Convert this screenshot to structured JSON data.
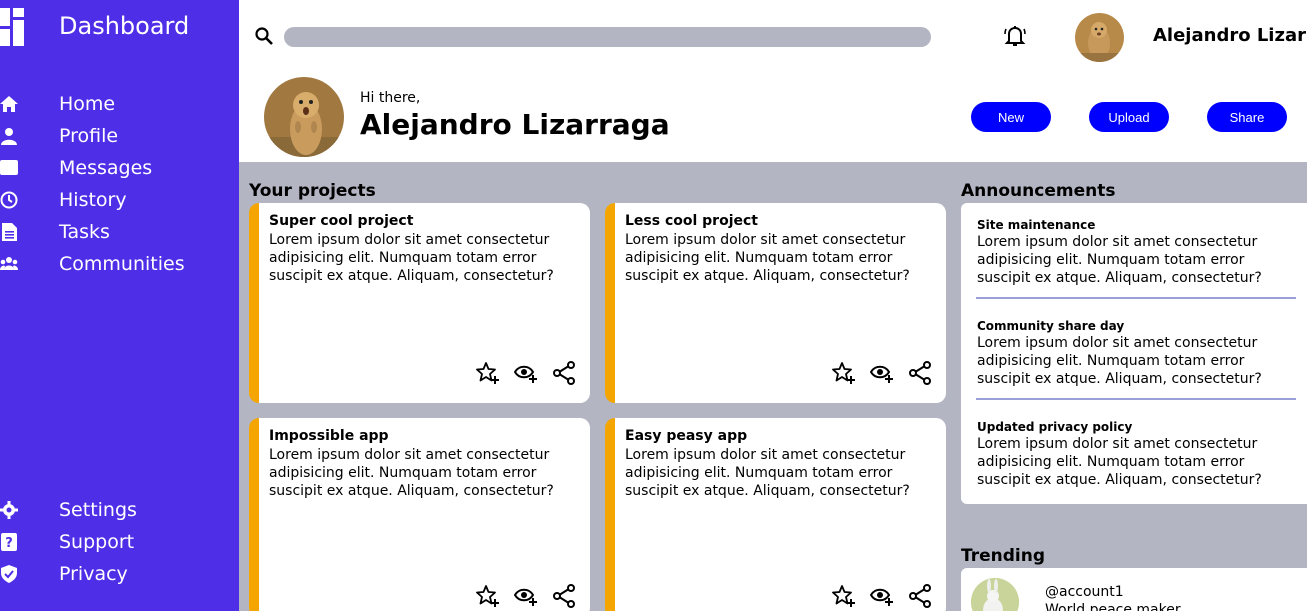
{
  "sidebar": {
    "title": "Dashboard",
    "items": [
      {
        "label": "Home",
        "icon": "home-icon"
      },
      {
        "label": "Profile",
        "icon": "user-icon"
      },
      {
        "label": "Messages",
        "icon": "message-icon"
      },
      {
        "label": "History",
        "icon": "history-icon"
      },
      {
        "label": "Tasks",
        "icon": "document-icon"
      },
      {
        "label": "Communities",
        "icon": "group-icon"
      }
    ],
    "bottom_items": [
      {
        "label": "Settings",
        "icon": "gear-icon"
      },
      {
        "label": "Support",
        "icon": "help-icon"
      },
      {
        "label": "Privacy",
        "icon": "shield-icon"
      }
    ]
  },
  "header": {
    "search_placeholder": "",
    "user_name": "Alejandro Lizarraga",
    "greeting": "Hi there,",
    "big_name": "Alejandro Lizarraga",
    "buttons": {
      "new": "New",
      "upload": "Upload",
      "share": "Share"
    }
  },
  "projects": {
    "title": "Your projects",
    "items": [
      {
        "title": "Super cool project",
        "body": "Lorem ipsum dolor sit amet consectetur adipisicing elit. Numquam totam error suscipit ex atque. Aliquam, consectetur?"
      },
      {
        "title": "Less cool project",
        "body": "Lorem ipsum dolor sit amet consectetur adipisicing elit. Numquam totam error suscipit ex atque. Aliquam, consectetur?"
      },
      {
        "title": "Impossible app",
        "body": "Lorem ipsum dolor sit amet consectetur adipisicing elit. Numquam totam error suscipit ex atque. Aliquam, consectetur?"
      },
      {
        "title": "Easy peasy app",
        "body": "Lorem ipsum dolor sit amet consectetur adipisicing elit. Numquam totam error suscipit ex atque. Aliquam, consectetur?"
      }
    ]
  },
  "announcements": {
    "title": "Announcements",
    "items": [
      {
        "title": "Site maintenance",
        "body": "Lorem ipsum dolor sit amet consectetur adipisicing elit. Numquam totam error suscipit ex atque. Aliquam, consectetur?"
      },
      {
        "title": "Community share day",
        "body": "Lorem ipsum dolor sit amet consectetur adipisicing elit. Numquam totam error suscipit ex atque. Aliquam, consectetur?"
      },
      {
        "title": "Updated privacy policy",
        "body": "Lorem ipsum dolor sit amet consectetur adipisicing elit. Numquam totam error suscipit ex atque. Aliquam, consectetur?"
      }
    ]
  },
  "trending": {
    "title": "Trending",
    "items": [
      {
        "account": "@account1",
        "desc": "World peace maker"
      }
    ]
  },
  "colors": {
    "sidebar": "#4f2ee8",
    "background": "#b3b6c2",
    "accent": "#f5a500",
    "button": "#0000ff"
  }
}
